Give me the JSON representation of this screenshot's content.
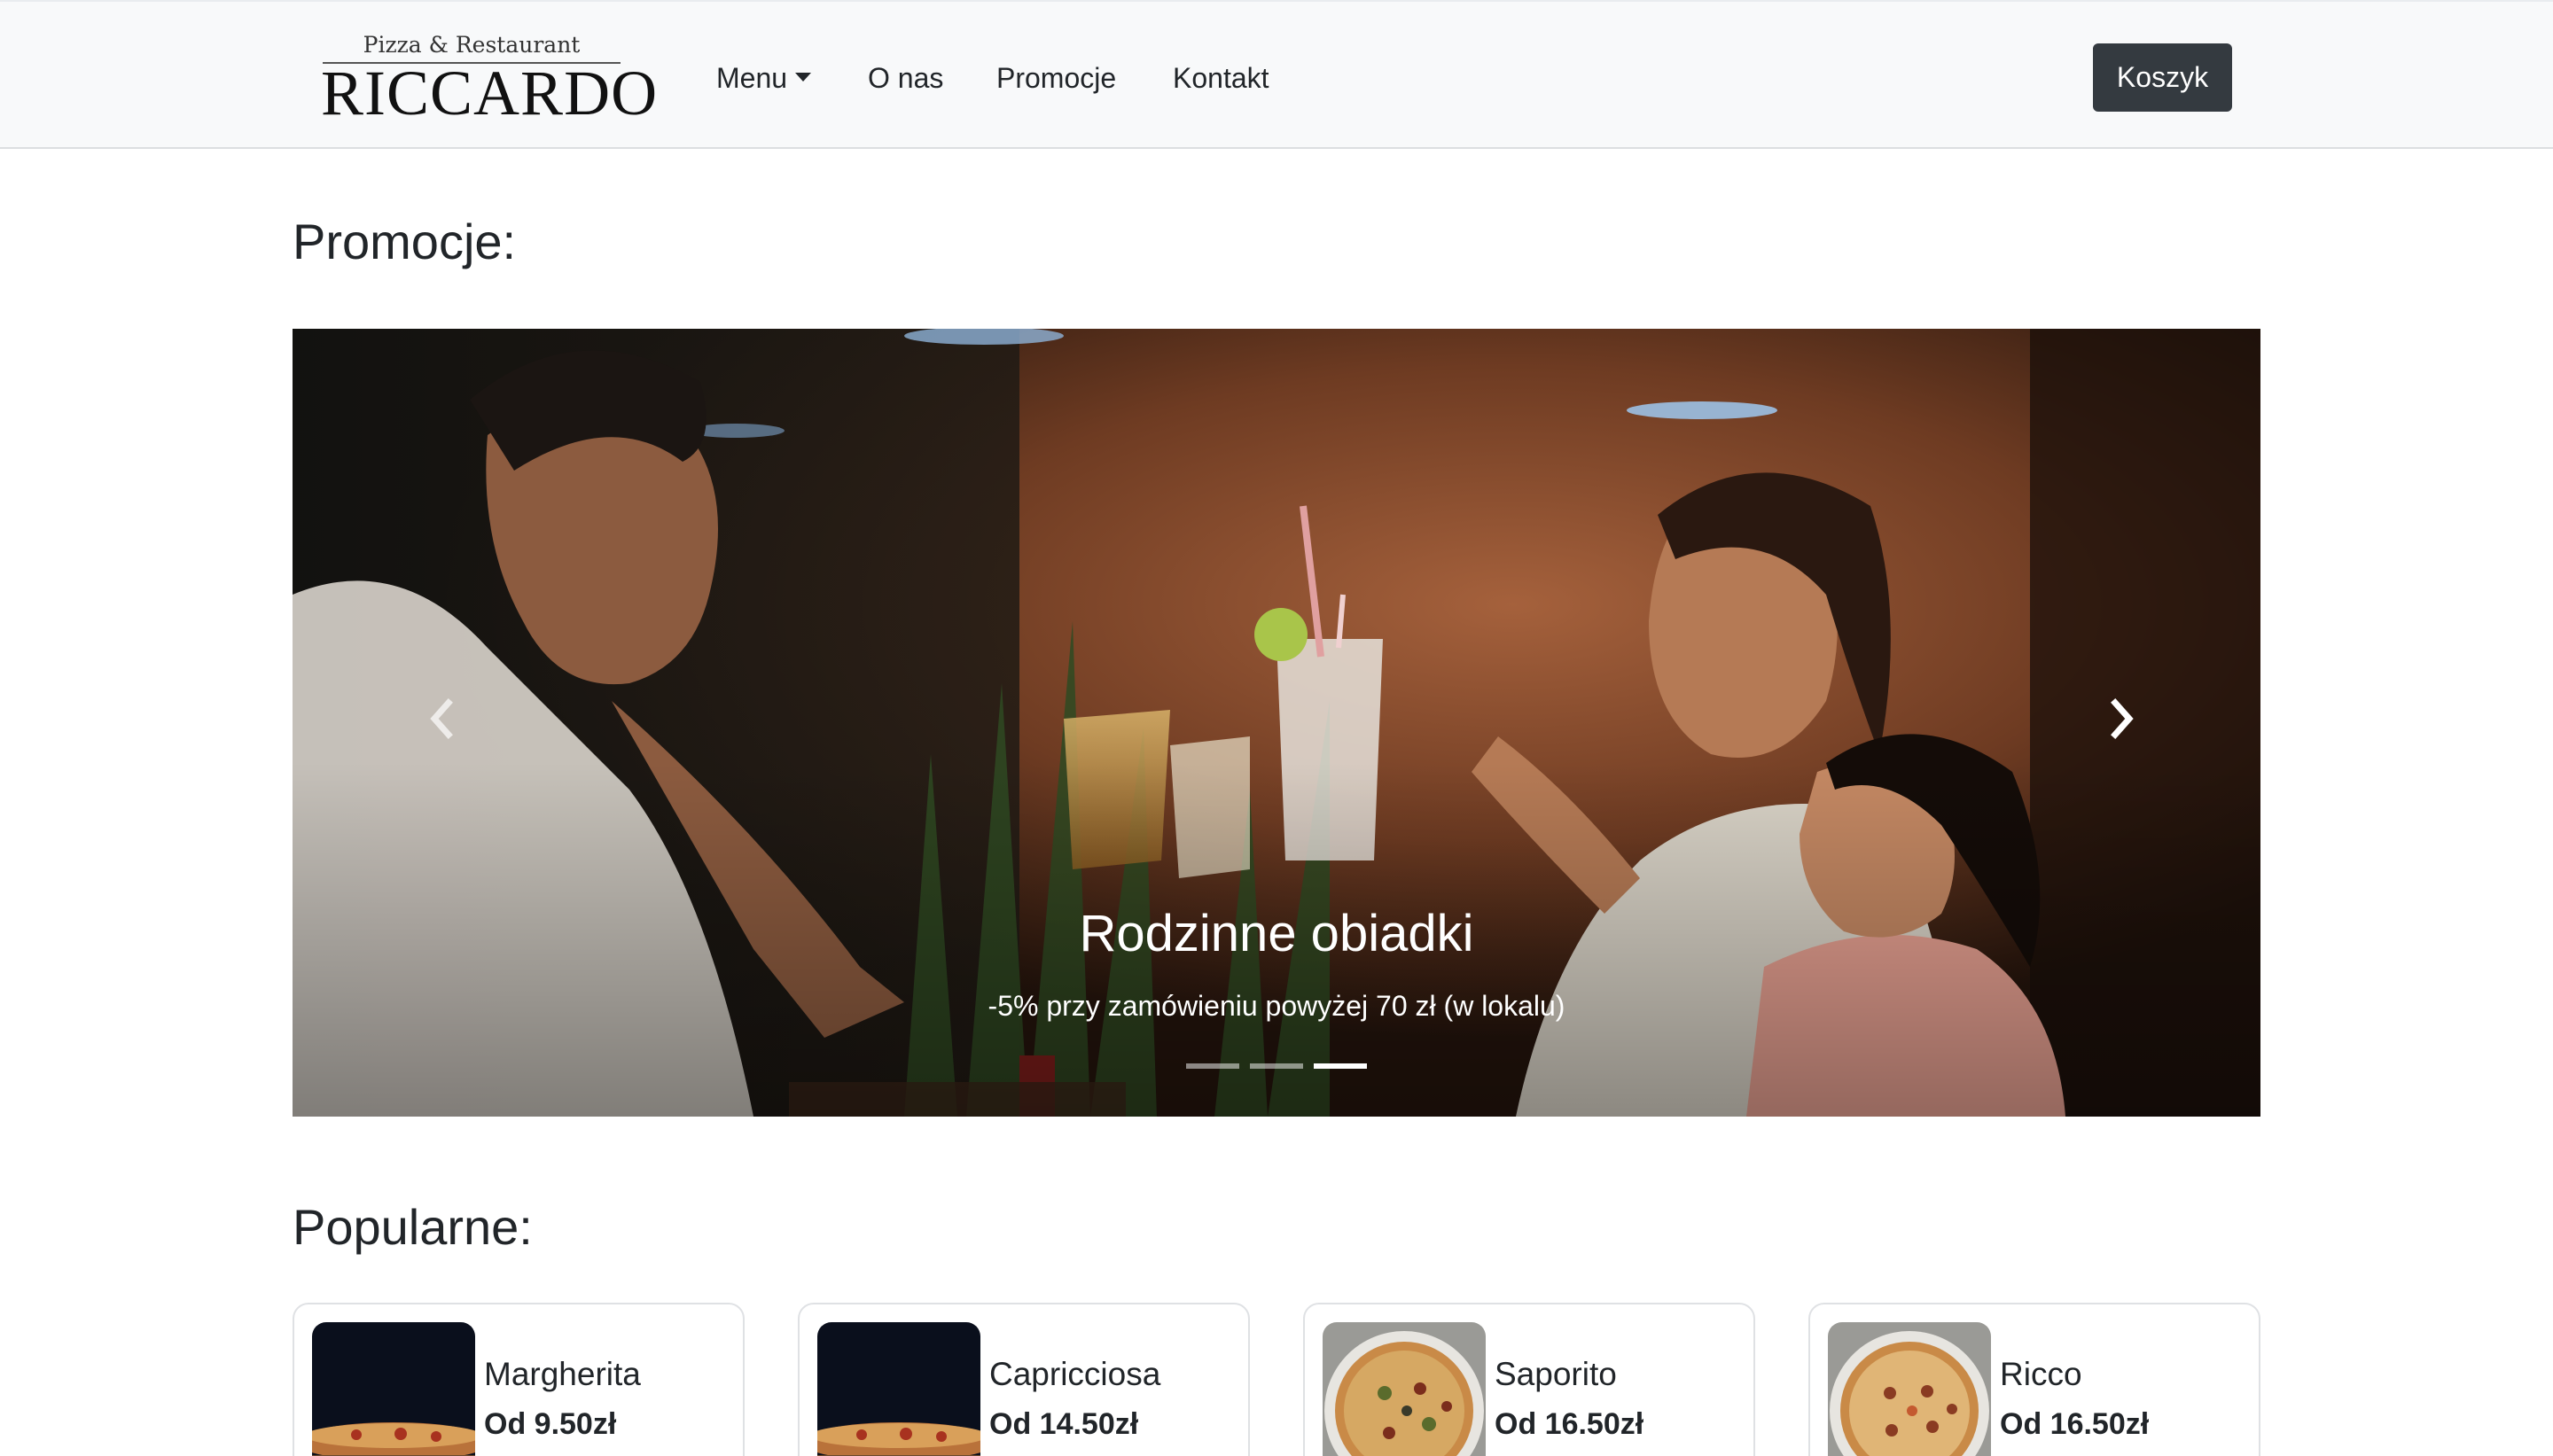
{
  "navbar": {
    "brand_subtitle": "Pizza & Restaurant",
    "brand_name": "RICCARDO",
    "links": {
      "menu": "Menu",
      "about": "O nas",
      "promotions": "Promocje",
      "contact": "Kontakt"
    },
    "cart_button": "Koszyk"
  },
  "promotions": {
    "heading": "Promocje:",
    "carousel": {
      "active_slide": {
        "title": "Rodzinne obiadki",
        "text": "-5% przy zamówieniu powyżej 70 zł (w lokalu)"
      },
      "slide_count": 3,
      "active_index": 2,
      "prev_icon": "chevron-left-icon",
      "next_icon": "chevron-right-icon"
    }
  },
  "popular": {
    "heading": "Popularne:",
    "items": [
      {
        "name": "Margherita",
        "price": "Od 9.50zł",
        "image": "pizza-side-view"
      },
      {
        "name": "Capricciosa",
        "price": "Od 14.50zł",
        "image": "pizza-side-view"
      },
      {
        "name": "Saporito",
        "price": "Od 16.50zł",
        "image": "pizza-top-view"
      },
      {
        "name": "Ricco",
        "price": "Od 16.50zł",
        "image": "pizza-top-view"
      }
    ]
  },
  "colors": {
    "navbar_bg": "#f8f9fa",
    "button_dark": "#343a40",
    "text": "#212529"
  }
}
